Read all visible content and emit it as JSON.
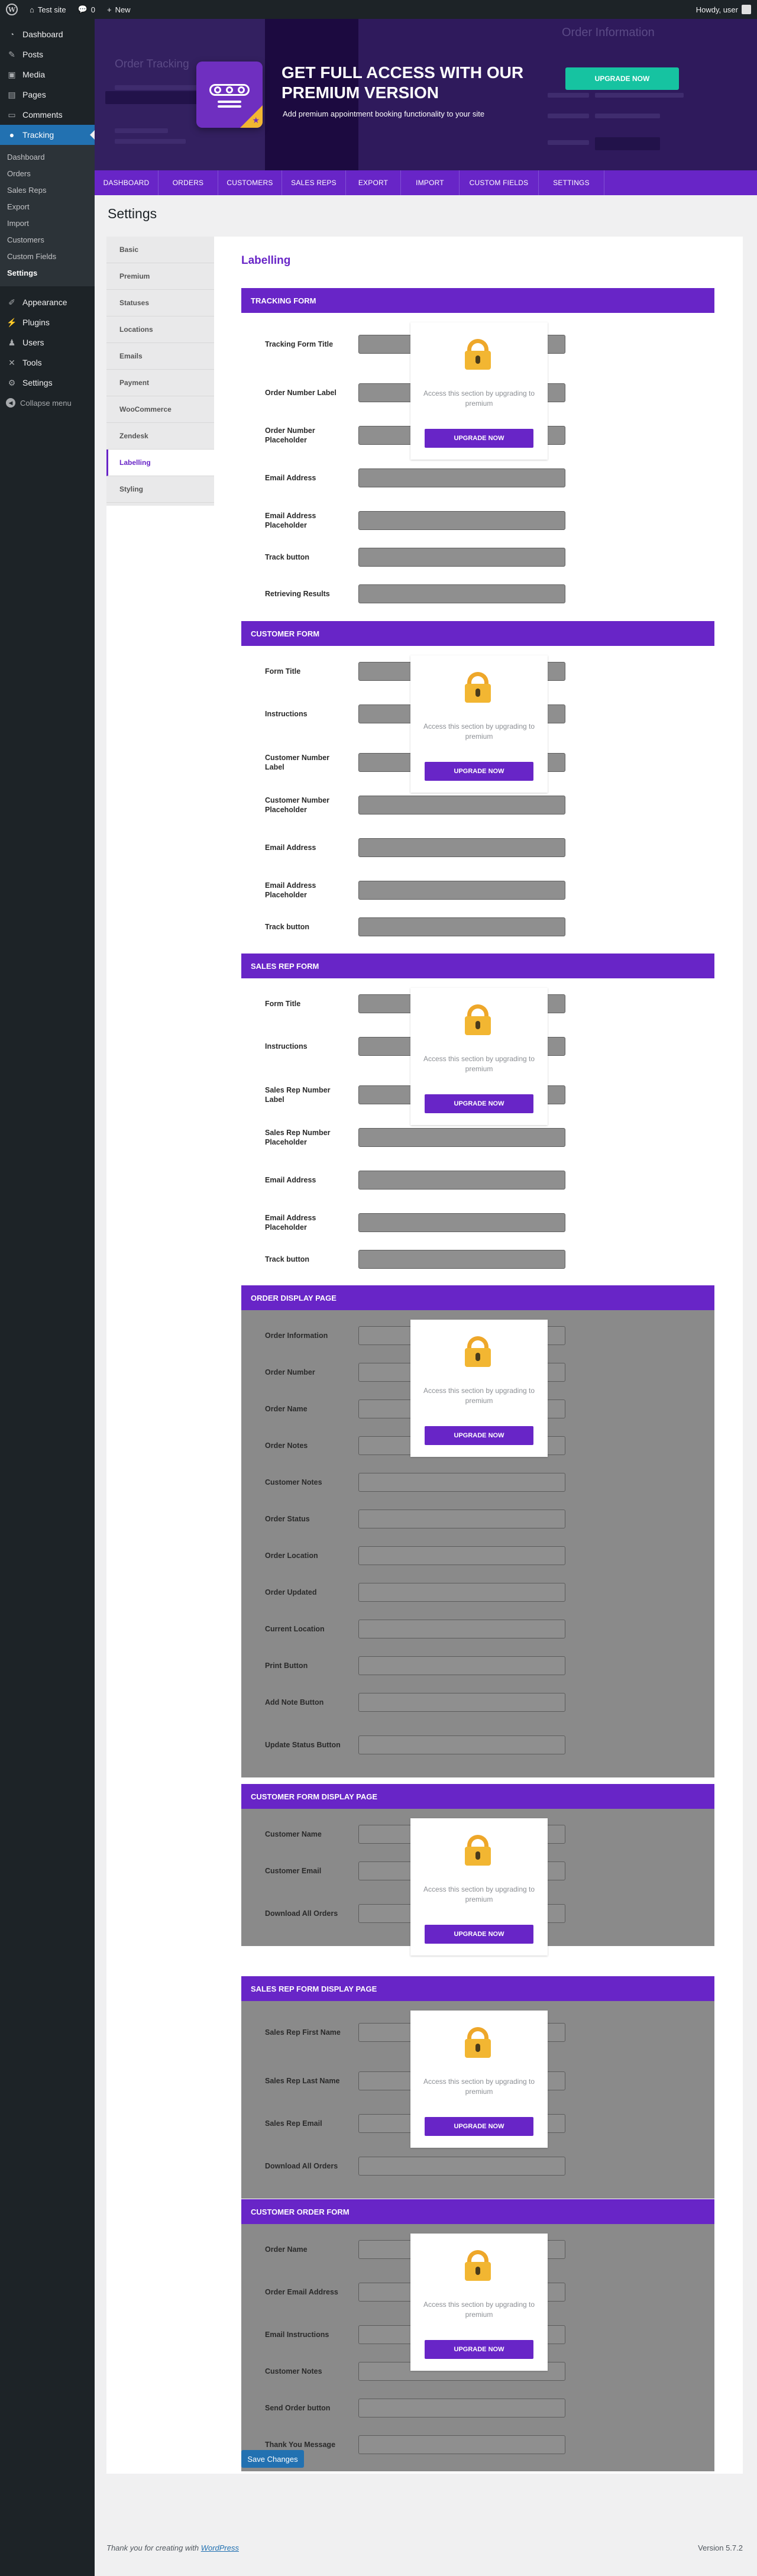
{
  "admin_bar": {
    "site_name": "Test site",
    "comments_count": "0",
    "new_label": "New",
    "howdy": "Howdy, user"
  },
  "sidebar": {
    "items": [
      {
        "label": "Dashboard",
        "icon": "dashboard-icon"
      },
      {
        "label": "Posts",
        "icon": "pin-icon"
      },
      {
        "label": "Media",
        "icon": "media-icon"
      },
      {
        "label": "Pages",
        "icon": "page-icon"
      },
      {
        "label": "Comments",
        "icon": "comment-icon"
      },
      {
        "label": "Tracking",
        "icon": "location-pin-icon",
        "current": true
      }
    ],
    "submenu": [
      "Dashboard",
      "Orders",
      "Sales Reps",
      "Export",
      "Import",
      "Customers",
      "Custom Fields",
      "Settings"
    ],
    "submenu_active": "Settings",
    "items2": [
      {
        "label": "Appearance",
        "icon": "paintbrush-icon"
      },
      {
        "label": "Plugins",
        "icon": "plugin-icon"
      },
      {
        "label": "Users",
        "icon": "users-icon"
      },
      {
        "label": "Tools",
        "icon": "wrench-icon"
      },
      {
        "label": "Settings",
        "icon": "settings-icon"
      }
    ],
    "collapse_label": "Collapse menu"
  },
  "banner": {
    "ghost_left_title": "Order Tracking",
    "ghost_right_title": "Order Information",
    "title": "GET FULL ACCESS WITH OUR PREMIUM VERSION",
    "subtitle": "Add premium appointment booking functionality to your site",
    "button": "UPGRADE NOW"
  },
  "tabs": [
    "DASHBOARD",
    "ORDERS",
    "CUSTOMERS",
    "SALES REPS",
    "EXPORT",
    "IMPORT",
    "CUSTOM FIELDS",
    "SETTINGS"
  ],
  "page_title": "Settings",
  "settings_nav": [
    "Basic",
    "Premium",
    "Statuses",
    "Locations",
    "Emails",
    "Payment",
    "WooCommerce",
    "Zendesk",
    "Labelling",
    "Styling"
  ],
  "settings_nav_active": "Labelling",
  "labelling_title": "Labelling",
  "premium_overlay": {
    "text": "Access this section by upgrading to premium",
    "button": "UPGRADE NOW"
  },
  "sections": [
    {
      "title": "TRACKING FORM",
      "fields": [
        "Tracking Form Title",
        "Order Number Label",
        "Order Number Placeholder",
        "Email Address",
        "Email Address Placeholder",
        "Track button",
        "Retrieving Results"
      ]
    },
    {
      "title": "CUSTOMER FORM",
      "fields": [
        "Form Title",
        "Instructions",
        "Customer Number Label",
        "Customer Number Placeholder",
        "Email Address",
        "Email Address Placeholder",
        "Track button"
      ]
    },
    {
      "title": "SALES REP FORM",
      "fields": [
        "Form Title",
        "Instructions",
        "Sales Rep Number Label",
        "Sales Rep Number Placeholder",
        "Email Address",
        "Email Address Placeholder",
        "Track button"
      ]
    },
    {
      "title": "ORDER DISPLAY PAGE",
      "fields": [
        "Order Information",
        "Order Number",
        "Order Name",
        "Order Notes",
        "Customer Notes",
        "Order Status",
        "Order Location",
        "Order Updated",
        "Current Location",
        "Print Button",
        "Add Note Button",
        "Update Status Button"
      ]
    },
    {
      "title": "CUSTOMER FORM DISPLAY PAGE",
      "fields": [
        "Customer Name",
        "Customer Email",
        "Download All Orders"
      ]
    },
    {
      "title": "SALES REP FORM DISPLAY PAGE",
      "fields": [
        "Sales Rep First Name",
        "Sales Rep Last Name",
        "Sales Rep Email",
        "Download All Orders"
      ]
    },
    {
      "title": "CUSTOMER ORDER FORM",
      "fields": [
        "Order Name",
        "Order Email Address",
        "Email Instructions",
        "Customer Notes",
        "Send Order button",
        "Thank You Message"
      ]
    }
  ],
  "save_button": "Save Changes",
  "footer": {
    "thanks_prefix": "Thank you for creating with",
    "thanks_link": "WordPress",
    "version": "Version 5.7.2"
  }
}
